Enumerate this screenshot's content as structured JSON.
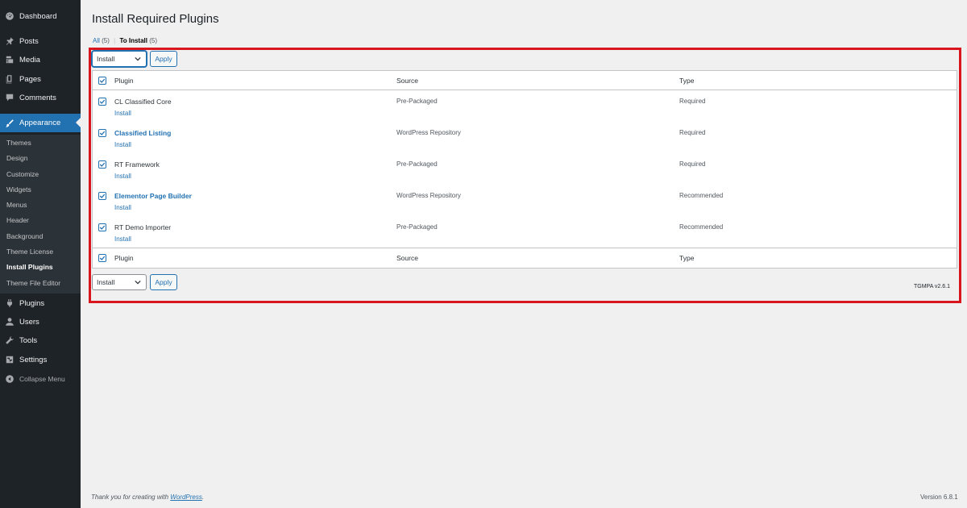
{
  "sidebar": {
    "top_items": [
      {
        "label": "Dashboard",
        "icon": "dashboard-icon"
      },
      {
        "label": "Posts",
        "icon": "pin-icon"
      },
      {
        "label": "Media",
        "icon": "media-icon"
      },
      {
        "label": "Pages",
        "icon": "pages-icon"
      },
      {
        "label": "Comments",
        "icon": "comments-icon"
      },
      {
        "label": "Appearance",
        "icon": "brush-icon"
      }
    ],
    "submenu": [
      "Themes",
      "Design",
      "Customize",
      "Widgets",
      "Menus",
      "Header",
      "Background",
      "Theme License",
      "Install Plugins",
      "Theme File Editor"
    ],
    "bottom_items": [
      {
        "label": "Plugins",
        "icon": "plugin-icon"
      },
      {
        "label": "Users",
        "icon": "users-icon"
      },
      {
        "label": "Tools",
        "icon": "wrench-icon"
      },
      {
        "label": "Settings",
        "icon": "settings-icon"
      }
    ],
    "collapse_label": "Collapse Menu"
  },
  "page": {
    "title": "Install Required Plugins",
    "filter_all": "All",
    "filter_all_count": "(5)",
    "filter_sep": "|",
    "filter_to_install": "To Install",
    "filter_to_install_count": "(5)"
  },
  "bulk": {
    "top_selected": "Install",
    "bottom_selected": "Install",
    "apply_label": "Apply"
  },
  "table": {
    "headers": {
      "plugin": "Plugin",
      "source": "Source",
      "type": "Type"
    },
    "rows": [
      {
        "name": "CL Classified Core",
        "action": "Install",
        "source": "Pre-Packaged",
        "type": "Required"
      },
      {
        "name": "Classified Listing",
        "action": "Install",
        "source": "WordPress Repository",
        "type": "Required"
      },
      {
        "name": "RT Framework",
        "action": "Install",
        "source": "Pre-Packaged",
        "type": "Required"
      },
      {
        "name": "Elementor Page Builder",
        "action": "Install",
        "source": "WordPress Repository",
        "type": "Recommended"
      },
      {
        "name": "RT Demo Importer",
        "action": "Install",
        "source": "Pre-Packaged",
        "type": "Recommended"
      }
    ]
  },
  "tgmpa_version": "TGMPA v2.6.1",
  "footer": {
    "thanks_prefix": "Thank you for creating with",
    "thanks_link": "WordPress",
    "thanks_suffix": ".",
    "version": "Version 6.8.1"
  },
  "colors": {
    "sidebar_bg": "#1d2327",
    "accent": "#2271b1",
    "highlight_border": "#d9151d"
  }
}
